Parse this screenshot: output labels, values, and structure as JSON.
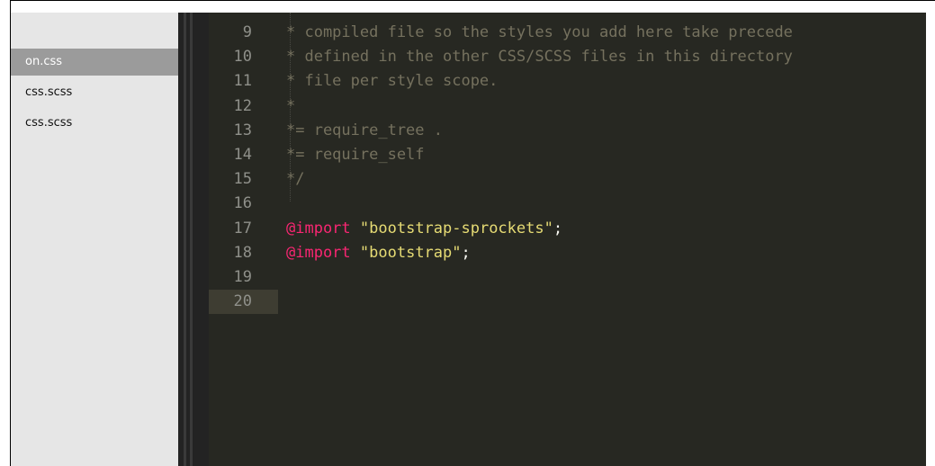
{
  "sidebar": {
    "items": [
      {
        "label": "on.css",
        "selected": true
      },
      {
        "label": "css.scss",
        "selected": false
      },
      {
        "label": "css.scss",
        "selected": false
      }
    ]
  },
  "editor": {
    "lines": [
      {
        "num": "9",
        "segments": [
          {
            "t": "* compiled file so the styles you add here take precede",
            "c": "comment"
          }
        ]
      },
      {
        "num": "10",
        "segments": [
          {
            "t": "* defined in the other CSS/SCSS files in this directory",
            "c": "comment"
          }
        ]
      },
      {
        "num": "11",
        "segments": [
          {
            "t": "* file per style scope.",
            "c": "comment"
          }
        ]
      },
      {
        "num": "12",
        "segments": [
          {
            "t": "*",
            "c": "comment"
          }
        ]
      },
      {
        "num": "13",
        "segments": [
          {
            "t": "*= require_tree .",
            "c": "comment"
          }
        ]
      },
      {
        "num": "14",
        "segments": [
          {
            "t": "*= require_self",
            "c": "comment"
          }
        ]
      },
      {
        "num": "15",
        "segments": [
          {
            "t": "*/",
            "c": "comment"
          }
        ]
      },
      {
        "num": "16",
        "segments": []
      },
      {
        "num": "17",
        "segments": [
          {
            "t": "@import",
            "c": "kw"
          },
          {
            "t": " ",
            "c": "plain"
          },
          {
            "t": "\"bootstrap-sprockets\"",
            "c": "str"
          },
          {
            "t": ";",
            "c": "plain"
          }
        ]
      },
      {
        "num": "18",
        "segments": [
          {
            "t": "@import",
            "c": "kw"
          },
          {
            "t": " ",
            "c": "plain"
          },
          {
            "t": "\"bootstrap\"",
            "c": "str"
          },
          {
            "t": ";",
            "c": "plain"
          }
        ]
      },
      {
        "num": "19",
        "segments": []
      },
      {
        "num": "20",
        "segments": [],
        "active": true
      }
    ]
  },
  "colors": {
    "background": "#272822",
    "comment": "#75715e",
    "keyword": "#f92672",
    "string": "#e6db74",
    "plain": "#f8f8f2",
    "line_number": "#8f908a",
    "active_line": "#3e3d32",
    "sidebar_bg": "#e6e6e6",
    "sidebar_selected": "#9b9b9b"
  }
}
